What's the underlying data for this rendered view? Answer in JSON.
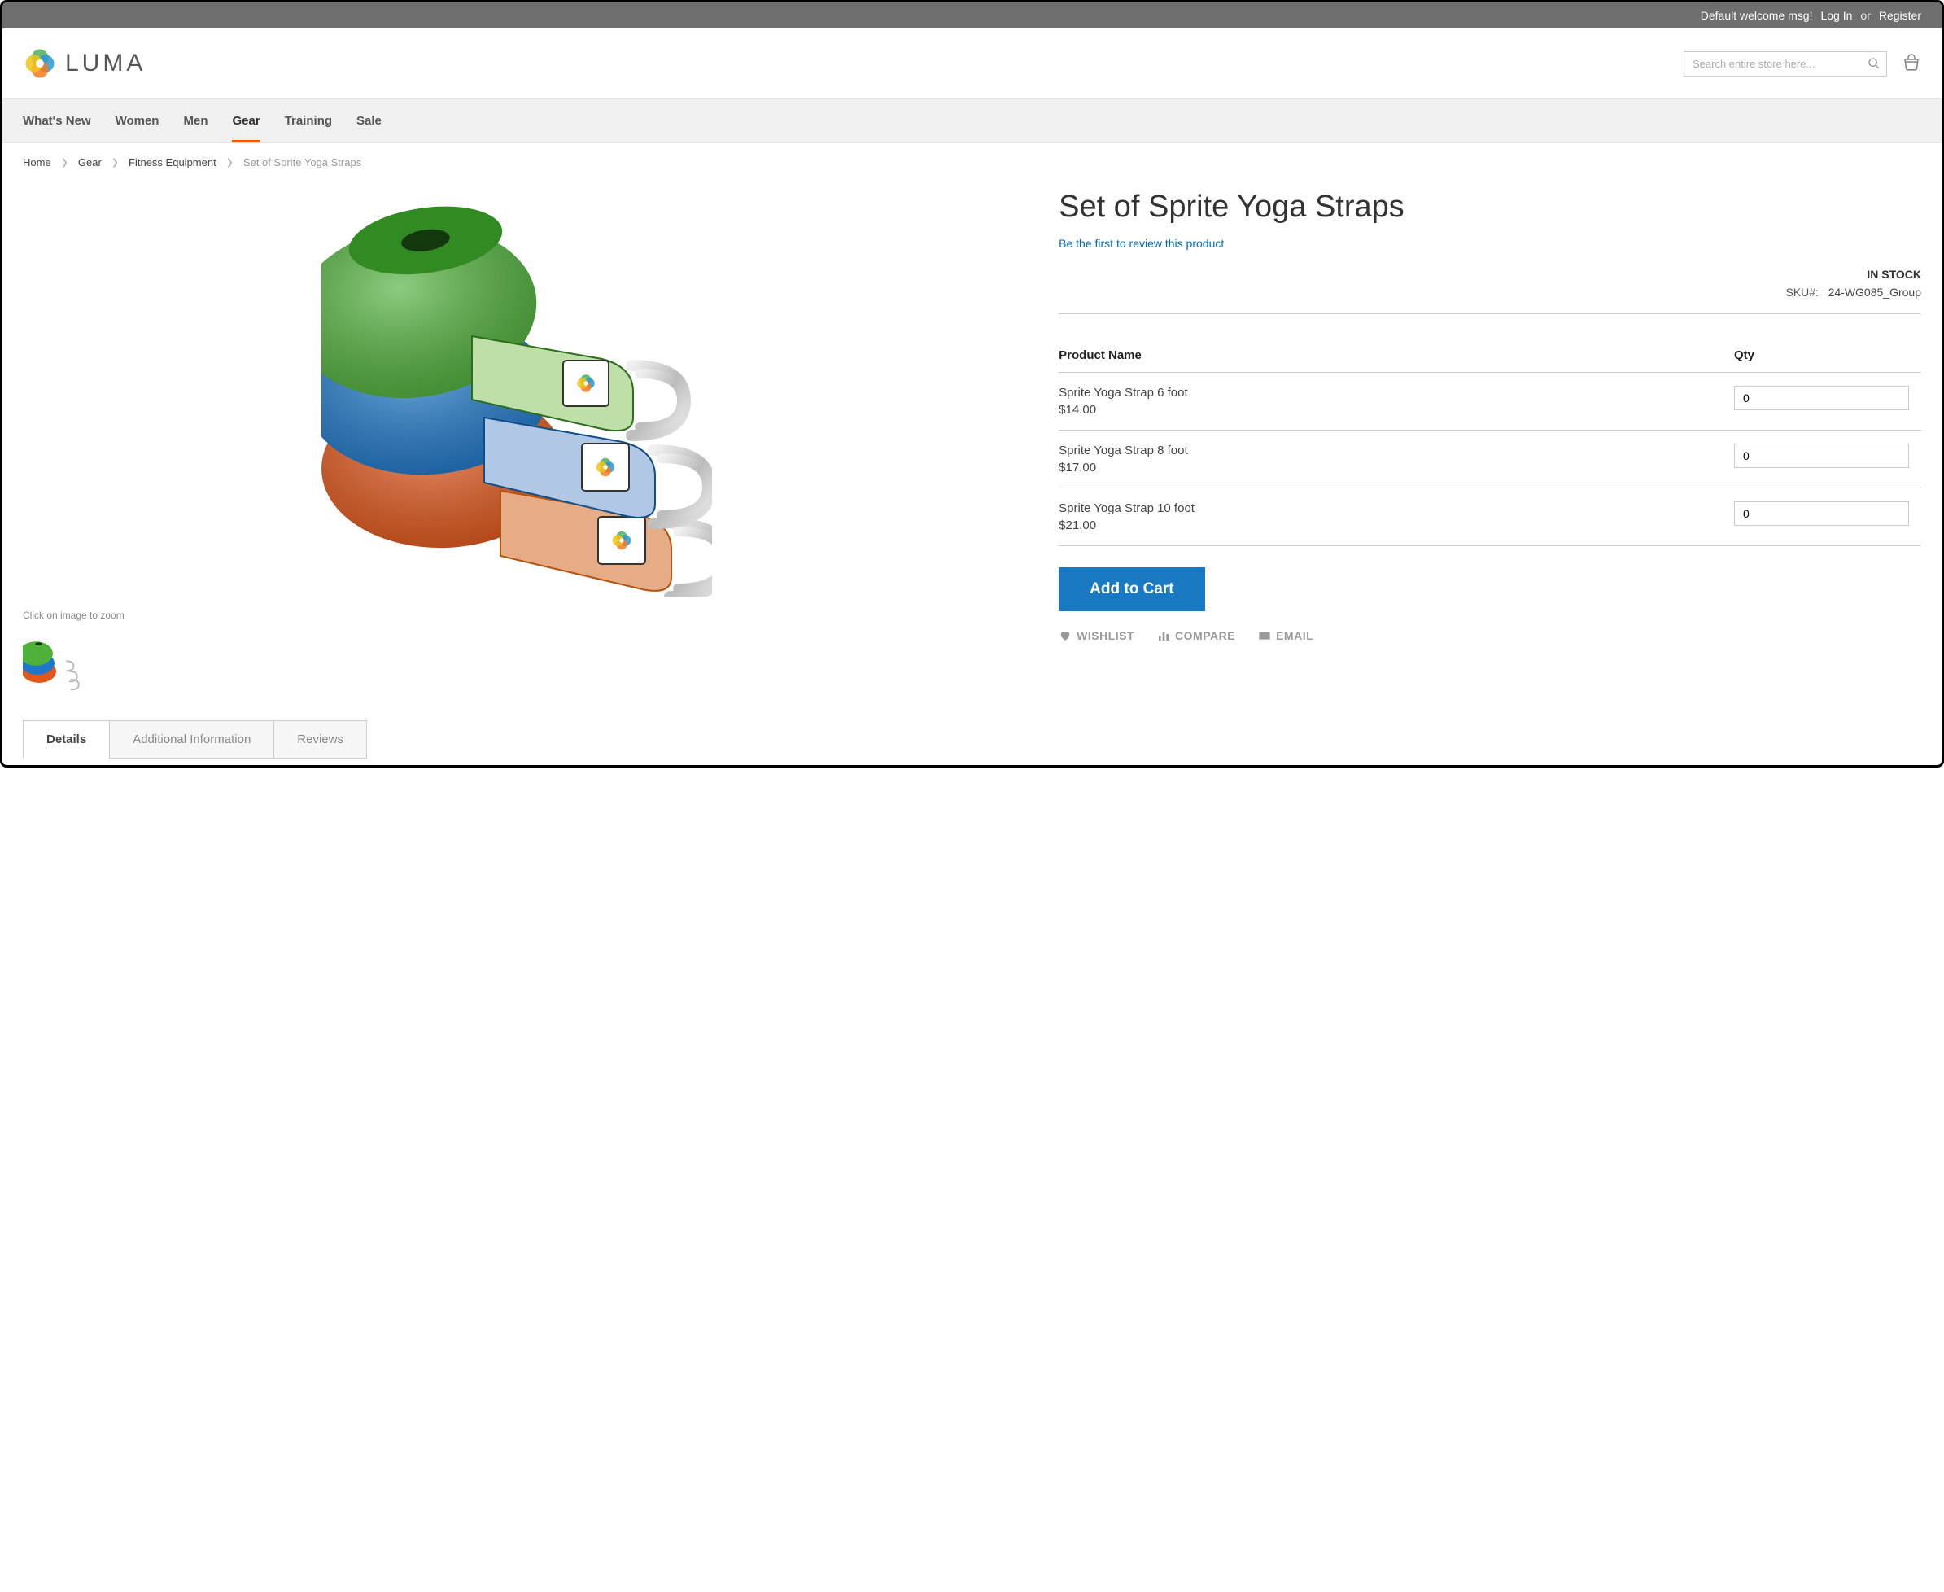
{
  "topbar": {
    "welcome": "Default welcome msg!",
    "login": "Log In",
    "or": "or",
    "register": "Register"
  },
  "header": {
    "brand": "LUMA",
    "search_placeholder": "Search entire store here..."
  },
  "nav": {
    "items": [
      "What's New",
      "Women",
      "Men",
      "Gear",
      "Training",
      "Sale"
    ],
    "active_index": 3
  },
  "breadcrumbs": {
    "items": [
      "Home",
      "Gear",
      "Fitness Equipment"
    ],
    "current": "Set of Sprite Yoga Straps"
  },
  "product": {
    "title": "Set of Sprite Yoga Straps",
    "review_cta": "Be the first to review this product",
    "stock_status": "IN STOCK",
    "sku_label": "SKU#:",
    "sku": "24-WG085_Group",
    "zoom_hint": "Click on image to zoom",
    "table": {
      "col_name": "Product Name",
      "col_qty": "Qty",
      "rows": [
        {
          "name": "Sprite Yoga Strap 6 foot",
          "price": "$14.00",
          "qty": "0"
        },
        {
          "name": "Sprite Yoga Strap 8 foot",
          "price": "$17.00",
          "qty": "0"
        },
        {
          "name": "Sprite Yoga Strap 10 foot",
          "price": "$21.00",
          "qty": "0"
        }
      ]
    },
    "add_to_cart": "Add to Cart",
    "actions": {
      "wishlist": "WISHLIST",
      "compare": "COMPARE",
      "email": "EMAIL"
    }
  },
  "tabs": {
    "items": [
      "Details",
      "Additional Information",
      "Reviews"
    ],
    "active_index": 0
  }
}
